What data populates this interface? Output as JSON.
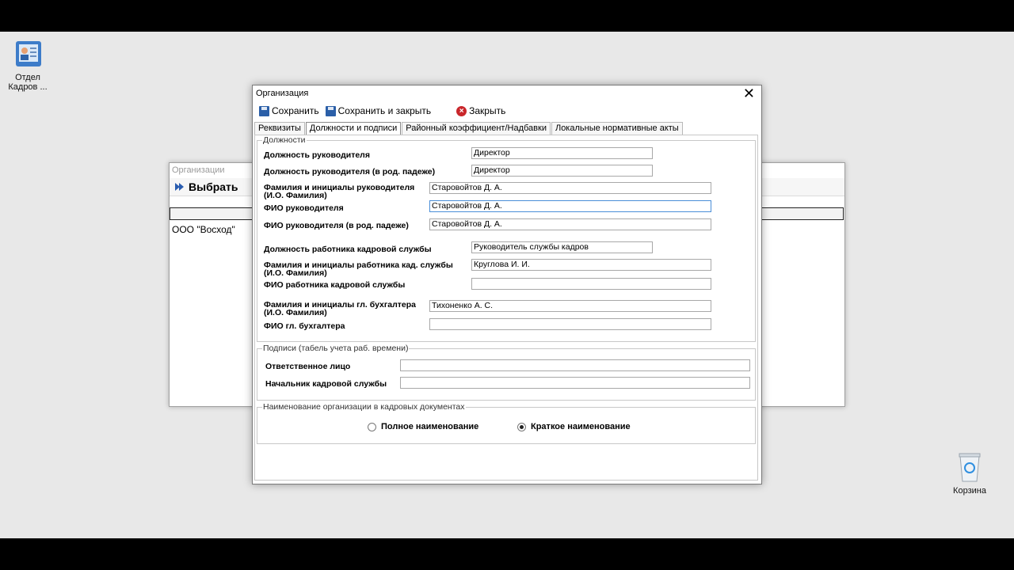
{
  "desktop": {
    "icon_hr": {
      "line1": "Отдел",
      "line2": "Кадров ..."
    },
    "icon_trash": {
      "label": "Корзина"
    }
  },
  "bg_window": {
    "title": "Организации",
    "select_label": "Выбрать",
    "row": "ООО \"Восход\""
  },
  "dialog": {
    "title": "Организация",
    "toolbar": {
      "save": "Сохранить",
      "save_close": "Сохранить и закрыть",
      "close": "Закрыть"
    },
    "tabs": [
      "Реквизиты",
      "Должности и подписи",
      "Районный коэффициент/Надбавки",
      "Локальные нормативные акты"
    ],
    "positions": {
      "legend": "Должности",
      "head_position": {
        "label": "Должность руководителя",
        "value": "Директор"
      },
      "head_position_gen": {
        "label": "Должность руководителя (в род. падеже)",
        "value": "Директор"
      },
      "head_initials": {
        "label1": "Фамилия и инициалы руководителя",
        "label2": "(И.О. Фамилия)",
        "value": "Старовойтов Д. А."
      },
      "head_fio": {
        "label": "ФИО руководителя",
        "value": "Старовойтов Д. А."
      },
      "head_fio_gen": {
        "label": "ФИО руководителя (в род. падеже)",
        "value": "Старовойтов Д. А."
      },
      "hr_position": {
        "label": "Должность работника кадровой службы",
        "value": "Руководитель службы кадров"
      },
      "hr_initials": {
        "label1": "Фамилия и инициалы работника кад. службы",
        "label2": "(И.О. Фамилия)",
        "value": "Круглова И. И."
      },
      "hr_fio": {
        "label": "ФИО работника кадровой службы",
        "value": ""
      },
      "acc_initials": {
        "label1": "Фамилия и инициалы гл. бухгалтера",
        "label2": "(И.О. Фамилия)",
        "value": "Тихоненко А. С."
      },
      "acc_fio": {
        "label": "ФИО гл. бухгалтера",
        "value": ""
      }
    },
    "signatures": {
      "legend": "Подписи (табель учета раб. времени)",
      "responsible": {
        "label": "Ответственное лицо",
        "value": ""
      },
      "hr_head": {
        "label": "Начальник кадровой службы",
        "value": ""
      }
    },
    "naming": {
      "legend": "Наименование организации в кадровых документах",
      "full": "Полное наименование",
      "short": "Краткое наименование",
      "selected": "short"
    }
  }
}
